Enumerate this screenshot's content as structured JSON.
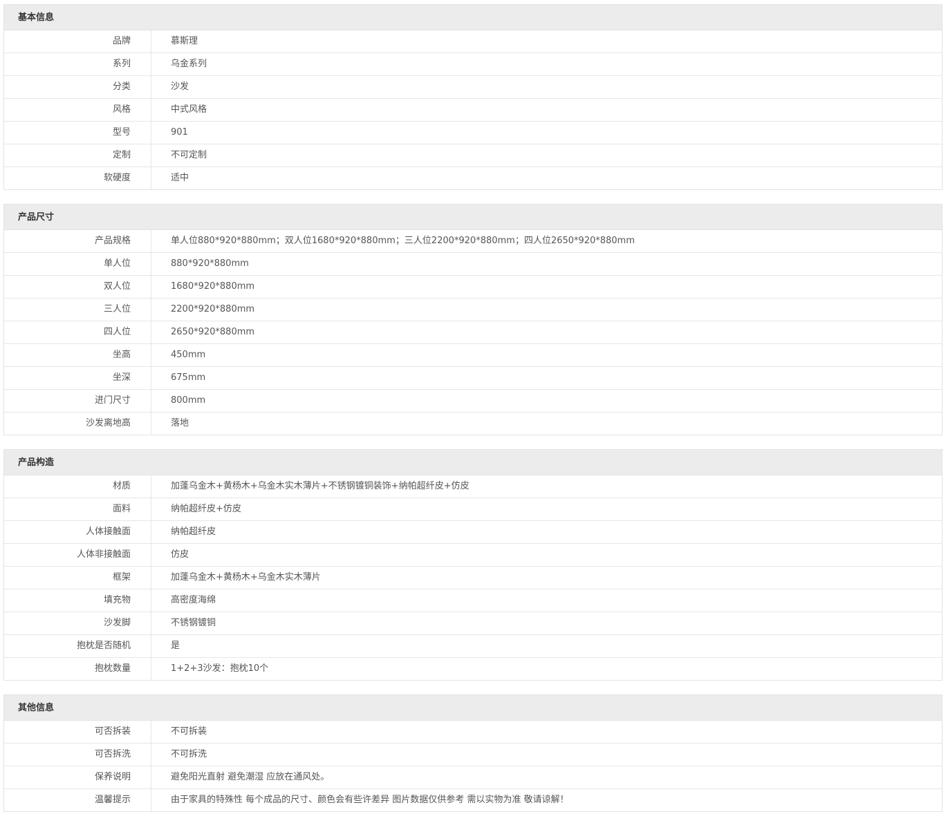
{
  "sections": [
    {
      "title": "基本信息",
      "rows": [
        {
          "label": "品牌",
          "value": "慕斯理"
        },
        {
          "label": "系列",
          "value": "乌金系列"
        },
        {
          "label": "分类",
          "value": "沙发"
        },
        {
          "label": "风格",
          "value": "中式风格"
        },
        {
          "label": "型号",
          "value": "901"
        },
        {
          "label": "定制",
          "value": "不可定制"
        },
        {
          "label": "软硬度",
          "value": "适中"
        }
      ]
    },
    {
      "title": "产品尺寸",
      "rows": [
        {
          "label": "产品规格",
          "value": "单人位880*920*880mm；双人位1680*920*880mm；三人位2200*920*880mm；四人位2650*920*880mm"
        },
        {
          "label": "单人位",
          "value": "880*920*880mm"
        },
        {
          "label": "双人位",
          "value": "1680*920*880mm"
        },
        {
          "label": "三人位",
          "value": "2200*920*880mm"
        },
        {
          "label": "四人位",
          "value": "2650*920*880mm"
        },
        {
          "label": "坐高",
          "value": "450mm"
        },
        {
          "label": "坐深",
          "value": "675mm"
        },
        {
          "label": "进门尺寸",
          "value": "800mm"
        },
        {
          "label": "沙发离地高",
          "value": "落地"
        }
      ]
    },
    {
      "title": "产品构造",
      "rows": [
        {
          "label": "材质",
          "value": "加蓬乌金木+黄杨木+乌金木实木薄片+不锈钢镀铜装饰+纳帕超纤皮+仿皮"
        },
        {
          "label": "面料",
          "value": "纳帕超纤皮+仿皮"
        },
        {
          "label": "人体接触面",
          "value": "纳帕超纤皮"
        },
        {
          "label": "人体非接触面",
          "value": "仿皮"
        },
        {
          "label": "框架",
          "value": "加蓬乌金木+黄杨木+乌金木实木薄片"
        },
        {
          "label": "填充物",
          "value": "高密度海绵"
        },
        {
          "label": "沙发脚",
          "value": "不锈钢镀铜"
        },
        {
          "label": "抱枕是否随机",
          "value": "是"
        },
        {
          "label": "抱枕数量",
          "value": "1+2+3沙发：抱枕10个"
        }
      ]
    },
    {
      "title": "其他信息",
      "rows": [
        {
          "label": "可否拆装",
          "value": "不可拆装"
        },
        {
          "label": "可否拆洗",
          "value": "不可拆洗"
        },
        {
          "label": "保养说明",
          "value": "避免阳光直射 避免潮湿 应放在通风处。"
        },
        {
          "label": "温馨提示",
          "value": "由于家具的特殊性 每个成品的尺寸、颜色会有些许差异 图片数据仅供参考 需以实物为准 敬请谅解！"
        }
      ]
    }
  ]
}
